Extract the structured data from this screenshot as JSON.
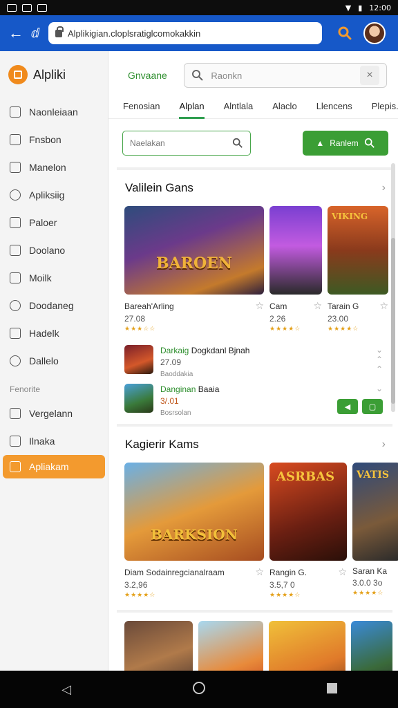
{
  "status": {
    "time": "12:00"
  },
  "browser": {
    "url": "Alplikigian.cloplsratiglcomokakkin"
  },
  "sidebar": {
    "brand": "Alpliki",
    "items": [
      {
        "label": "Naonleiaan"
      },
      {
        "label": "Fnsbon"
      },
      {
        "label": "Manelon"
      },
      {
        "label": "Apliksiig"
      },
      {
        "label": "Paloer"
      },
      {
        "label": "Doolano"
      },
      {
        "label": "Moilk"
      },
      {
        "label": "Doodaneg"
      },
      {
        "label": "Hadelk"
      },
      {
        "label": "Dallelo"
      }
    ],
    "section_label": "Fenorite",
    "items2": [
      {
        "label": "Vergelann"
      },
      {
        "label": "Ilnaka"
      },
      {
        "label": "Apliakam"
      }
    ]
  },
  "header": {
    "title": "Gnvaane",
    "search_placeholder": "Raonkn",
    "clear": "×"
  },
  "tabs": [
    "Fenosian",
    "Alplan",
    "Alntlala",
    "Alaclo",
    "Llencens",
    "Plepis..."
  ],
  "filter": {
    "placeholder": "Naelakan",
    "button_label": "Ranlem"
  },
  "section1": {
    "title": "Valilein Gans",
    "cards": [
      {
        "name": "Bareah'Arling",
        "price": "27.08",
        "stars": "★★★☆☆",
        "logo": "BAROEN"
      },
      {
        "name": "Cam",
        "price": "2.26",
        "stars": "★★★★☆"
      },
      {
        "name": "Tarain G",
        "price": "23.00",
        "stars": "★★★★☆",
        "logo": "VIKING"
      }
    ],
    "list": [
      {
        "title_green": "Darkaig",
        "title_rest": "Dogkdanl Bjnah",
        "sub": "27.09",
        "meta": "Baoddakia"
      },
      {
        "title_green": "Danginan",
        "title_rest": "Baaia",
        "sub": "3/.01",
        "meta": "Bosrsolan"
      }
    ]
  },
  "section2": {
    "title": "Kagierir Kams",
    "cards": [
      {
        "name": "Diam Sodainregcianalraam",
        "price": "3.2,96",
        "stars": "★★★★☆",
        "logo": "BARKSION"
      },
      {
        "name": "Rangin G.",
        "price": "3.5,7 0",
        "stars": "★★★★☆",
        "logo": "ASRBAS"
      },
      {
        "name": "Saran Ka",
        "price": "3.0.0 3o",
        "stars": "★★★★☆",
        "logo": "VATIS"
      }
    ]
  }
}
